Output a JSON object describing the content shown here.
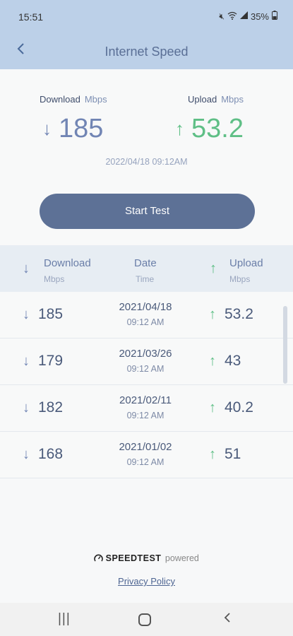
{
  "status_bar": {
    "time": "15:51",
    "battery": "35%",
    "icons": [
      "mute-icon",
      "wifi-icon",
      "signal-icon",
      "battery-icon"
    ]
  },
  "header": {
    "title": "Internet Speed",
    "back_icon": "chevron-left-icon"
  },
  "summary": {
    "download_label": "Download",
    "upload_label": "Upload",
    "unit": "Mbps",
    "download_value": "185",
    "upload_value": "53.2",
    "datetime": "2022/04/18 09:12AM",
    "start_button": "Start Test"
  },
  "table": {
    "headers": {
      "download": "Download",
      "download_unit": "Mbps",
      "date": "Date",
      "time": "Time",
      "upload": "Upload",
      "upload_unit": "Mbps"
    },
    "rows": [
      {
        "download": "185",
        "date": "2021/04/18",
        "time": "09:12 AM",
        "upload": "53.2"
      },
      {
        "download": "179",
        "date": "2021/03/26",
        "time": "09:12 AM",
        "upload": "43"
      },
      {
        "download": "182",
        "date": "2021/02/11",
        "time": "09:12 AM",
        "upload": "40.2"
      },
      {
        "download": "168",
        "date": "2021/01/02",
        "time": "09:12 AM",
        "upload": "51"
      }
    ]
  },
  "footer": {
    "brand": "SPEEDTEST",
    "powered": "powered",
    "privacy": "Privacy Policy"
  },
  "colors": {
    "header_bg": "#bcd0e8",
    "download_accent": "#7185b4",
    "upload_accent": "#5fbf86",
    "button_bg": "#5d7196"
  }
}
